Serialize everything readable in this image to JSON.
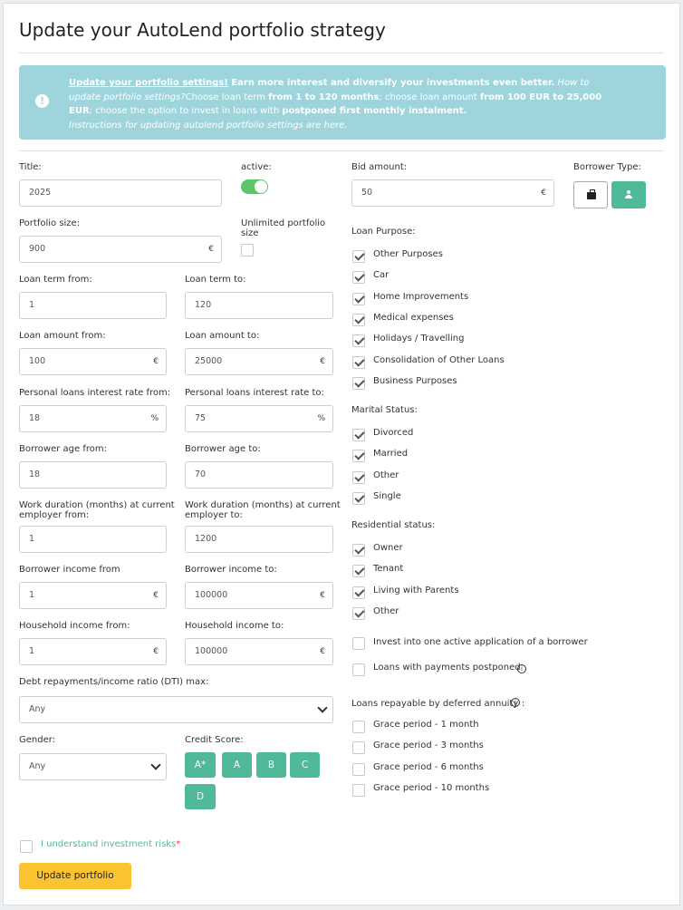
{
  "page_title": "Update your AutoLend portfolio strategy",
  "info": {
    "link1": "Update your portfolio settings!",
    "bold1": " Earn more interest and diversify your investments even better.",
    "italic1": " How to update portfolio settings?",
    "t1": "Choose loan term ",
    "b2": "from 1 to 120 months",
    "t2": "; choose loan amount ",
    "b3": "from 100 EUR to 25,000 EUR",
    "t3": "; choose the option to invest in loans with ",
    "b4": "postponed first monthly instalment.",
    "italic2": "Instructions for updating autolend portfolio settings are here."
  },
  "labels": {
    "title": "Title:",
    "active": "active:",
    "bid_amount": "Bid amount:",
    "borrower_type": "Borrower Type:",
    "portfolio_size": "Portfolio size:",
    "unlimited1": "Unlimited portfolio",
    "unlimited2": "size",
    "loan_term_from": "Loan term from:",
    "loan_term_to": "Loan term to:",
    "loan_amount_from": "Loan amount from:",
    "loan_amount_to": "Loan amount to:",
    "pl_rate_from": "Personal loans interest rate from:",
    "pl_rate_to": "Personal loans interest rate to:",
    "age_from": "Borrower age from:",
    "age_to": "Borrower age to:",
    "work_from1": "Work duration (months) at current",
    "work_from2": "employer from:",
    "work_to1": "Work duration (months) at current",
    "work_to2": "employer to:",
    "income_from": "Borrower income from",
    "income_to": "Borrower income to:",
    "hh_from": "Household income from:",
    "hh_to": "Household income to:",
    "dti": "Debt repayments/income ratio (DTI) max:",
    "gender": "Gender:",
    "credit_score": "Credit Score:",
    "loan_purpose": "Loan Purpose:",
    "marital": "Marital Status:",
    "residential": "Residential status:",
    "deferred": "Loans repayable by deferred annuity"
  },
  "values": {
    "title": "2025",
    "bid_amount": "50",
    "portfolio_size": "900",
    "loan_term_from": "1",
    "loan_term_to": "120",
    "loan_amount_from": "100",
    "loan_amount_to": "25000",
    "pl_rate_from": "18",
    "pl_rate_to": "75",
    "age_from": "18",
    "age_to": "70",
    "work_from": "1",
    "work_to": "1200",
    "income_from": "1",
    "income_to": "100000",
    "hh_from": "1",
    "hh_to": "100000",
    "dti": "Any",
    "gender": "Any"
  },
  "units": {
    "eur": "€",
    "pct": "%"
  },
  "credit_scores": [
    "A*",
    "A",
    "B",
    "C",
    "D"
  ],
  "loan_purposes": [
    "Other Purposes",
    "Car",
    "Home Improvements",
    "Medical expenses",
    "Holidays / Travelling",
    "Consolidation of Other Loans",
    "Business Purposes"
  ],
  "marital_statuses": [
    "Divorced",
    "Married",
    "Other",
    "Single"
  ],
  "residential_statuses": [
    "Owner",
    "Tenant",
    "Living with Parents",
    "Other"
  ],
  "options": {
    "one_application": "Invest into one active application of a borrower",
    "postponed": "Loans with payments postponed"
  },
  "grace_periods": [
    "Grace period - 1 month",
    "Grace period - 3 months",
    "Grace period - 6 months",
    "Grace period - 10 months"
  ],
  "risk_label": "I understand investment risks",
  "risk_required": "*",
  "update_button": "Update portfolio",
  "colors": {
    "accent": "#4fb99a",
    "info_bg": "#9ed5dd",
    "button": "#fcc331",
    "toggle": "#5cc56b"
  }
}
